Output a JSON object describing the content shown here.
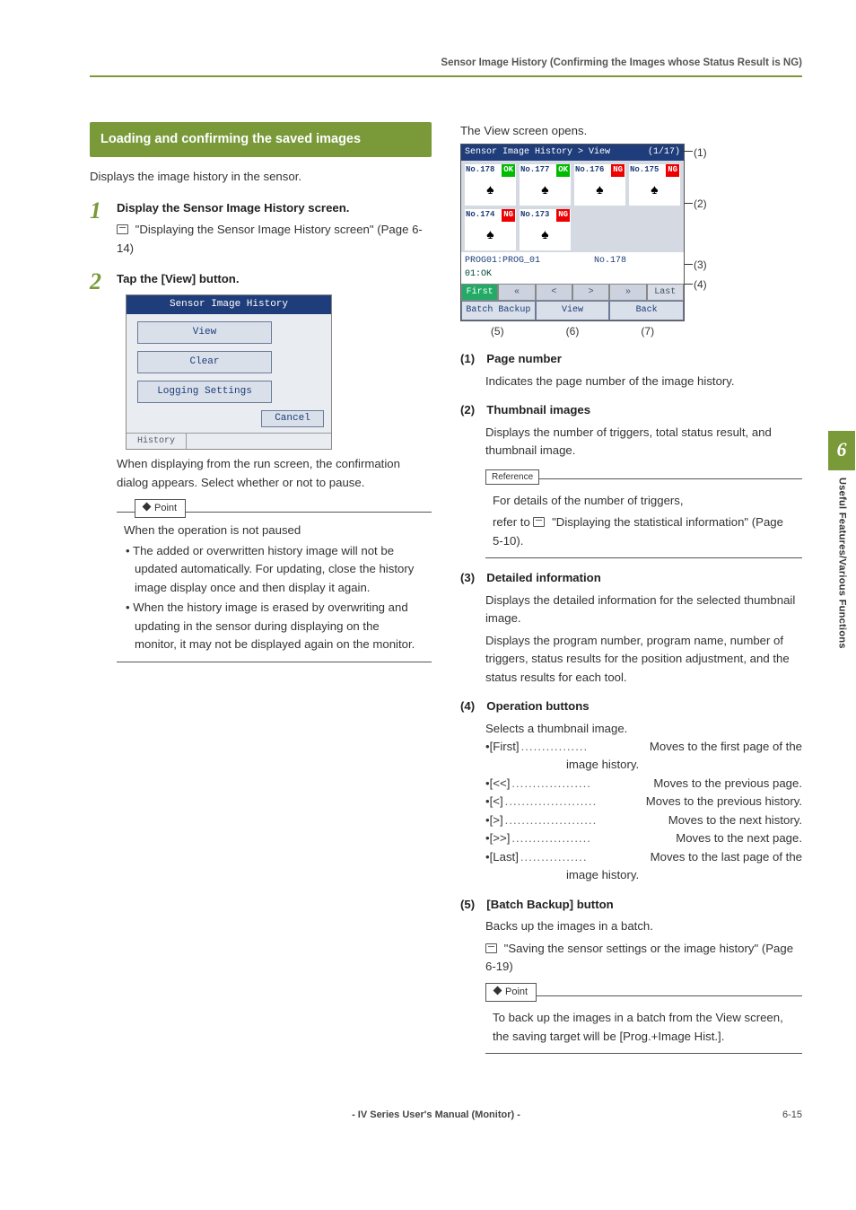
{
  "running_head": "Sensor Image History (Confirming the Images whose Status Result is NG)",
  "left": {
    "section_title": "Loading and confirming the saved images",
    "intro": "Displays the image history in the sensor.",
    "step1": {
      "title": "Display the Sensor Image History screen.",
      "ref": "\"Displaying the Sensor Image History screen\" (Page 6-14)"
    },
    "step2": {
      "title": "Tap the [View] button.",
      "menu_title": "Sensor Image History",
      "btn_view": "View",
      "btn_clear": "Clear",
      "btn_log": "Logging Settings",
      "btn_cancel": "Cancel",
      "tab_history": "History",
      "after": "When displaying from the run screen, the confirmation dialog appears. Select whether or not to pause.",
      "point_label": "Point",
      "point_intro": "When the operation is not paused",
      "point_b1": "The added or overwritten history image will not be updated automatically. For updating, close the history image display once and then display it again.",
      "point_b2": "When the history image is erased by overwriting and updating in the sensor during displaying on the monitor, it may not be displayed again on the monitor."
    }
  },
  "right": {
    "opens_text": "The View screen opens.",
    "vs": {
      "breadcrumb": "Sensor Image History > View",
      "page": "(1/17)",
      "thumbs": [
        {
          "no": "No.178",
          "st": "OK"
        },
        {
          "no": "No.177",
          "st": "OK"
        },
        {
          "no": "No.176",
          "st": "NG"
        },
        {
          "no": "No.175",
          "st": "NG"
        },
        {
          "no": "No.174",
          "st": "NG"
        },
        {
          "no": "No.173",
          "st": "NG"
        }
      ],
      "info_prog": "PROG01:PROG_01",
      "info_no": "No.178",
      "info_stat": "01:OK",
      "nav_first": "First",
      "nav_pp": "«",
      "nav_p": "<",
      "nav_n": ">",
      "nav_nn": "»",
      "nav_last": "Last",
      "btn_batch": "Batch Backup",
      "btn_view": "View",
      "btn_back": "Back"
    },
    "callouts": {
      "c1": "(1)",
      "c2": "(2)",
      "c3": "(3)",
      "c4": "(4)",
      "c5": "(5)",
      "c6": "(6)",
      "c7": "(7)"
    },
    "items": {
      "i1": {
        "hd": "(1) Page number",
        "bd": "Indicates the page number of the image history."
      },
      "i2": {
        "hd": "(2) Thumbnail images",
        "bd": "Displays the number of triggers, total status result, and thumbnail image.",
        "ref_label": "Reference",
        "ref_body1": "For details of the number of triggers,",
        "ref_body2": "refer to ",
        "ref_link": "\"Displaying the statistical information\" (Page 5-10)."
      },
      "i3": {
        "hd": "(3) Detailed information",
        "bd1": "Displays the detailed information for the selected thumbnail image.",
        "bd2": "Displays the program number, program name, number of triggers, status results for the position adjustment, and the status results for each tool."
      },
      "i4": {
        "hd": "(4) Operation buttons",
        "bd_intro": "Selects a thumbnail image.",
        "ops": [
          {
            "k": "[First]",
            "v": "Moves to the first page of the",
            "cont": "image history."
          },
          {
            "k": "[<<]",
            "v": "Moves to the previous page."
          },
          {
            "k": "[<]",
            "v": "Moves to the previous history."
          },
          {
            "k": "[>]",
            "v": "Moves to the next history."
          },
          {
            "k": "[>>]",
            "v": "Moves to the next page."
          },
          {
            "k": "[Last]",
            "v": "Moves to the last page of the",
            "cont": "image history."
          }
        ]
      },
      "i5": {
        "hd": "(5) [Batch Backup] button",
        "bd": "Backs up the images in a batch.",
        "ref": "\"Saving the sensor settings or the image history\" (Page 6-19)",
        "point_label": "Point",
        "point_body": "To back up the images in a batch from the View screen, the saving target will be [Prog.+Image Hist.]."
      }
    }
  },
  "sidetab": {
    "num": "6",
    "label": "Useful Features/Various Functions"
  },
  "footer": {
    "center": "- IV Series User's Manual (Monitor) -",
    "right": "6-15"
  }
}
